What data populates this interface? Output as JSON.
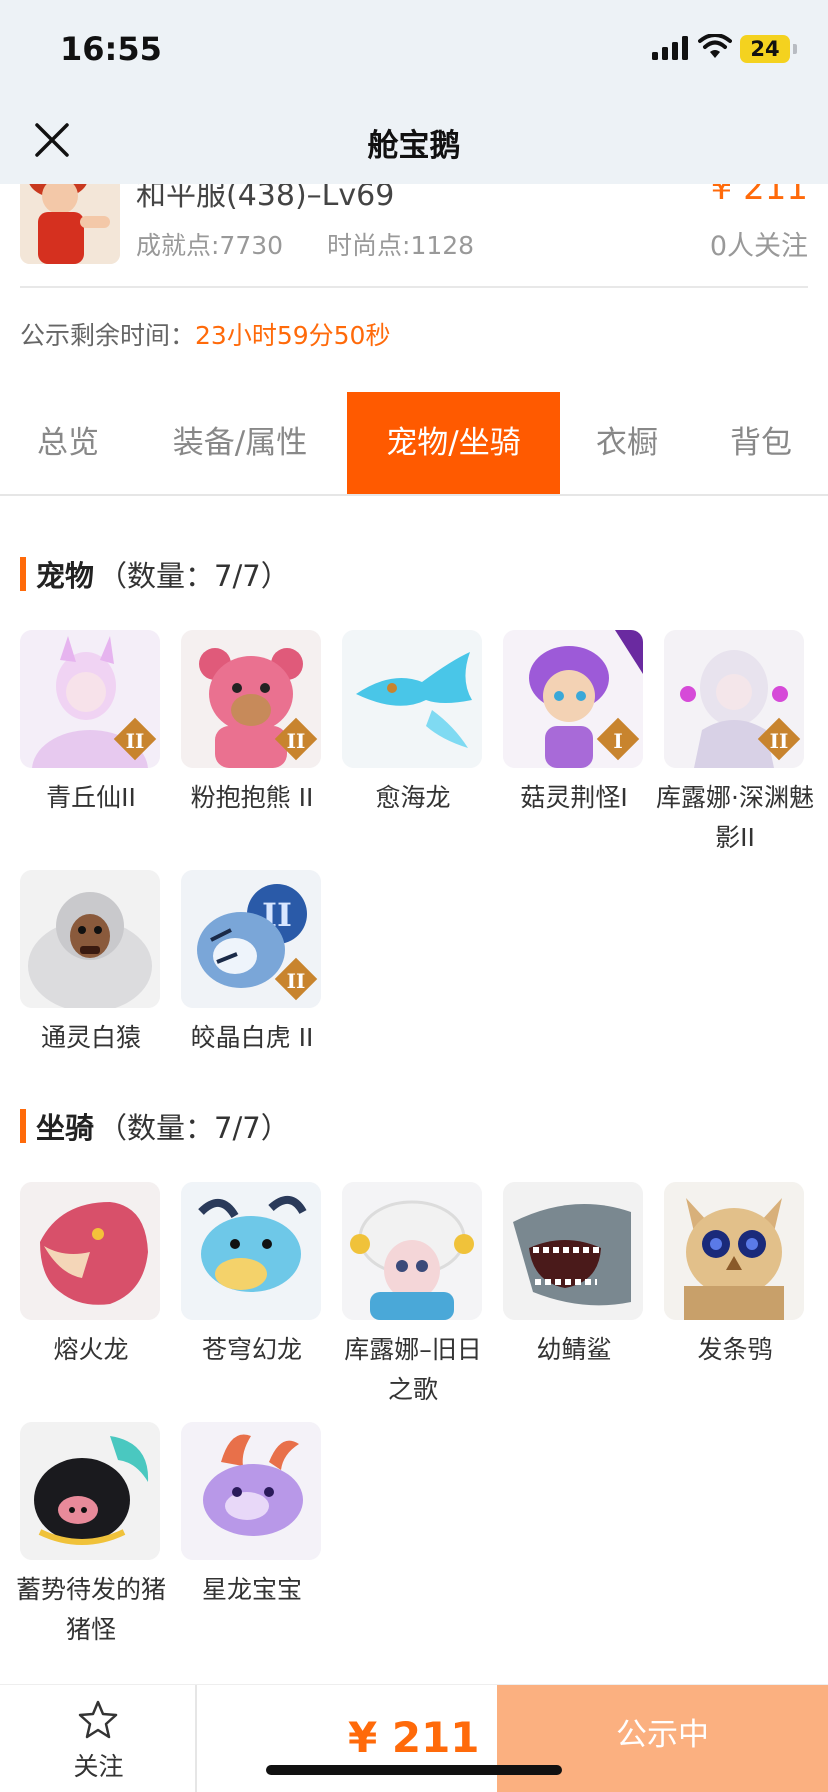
{
  "status_bar": {
    "time": "16:55",
    "battery": "24"
  },
  "nav": {
    "title": "舱宝鹅"
  },
  "account": {
    "title": "和平服(438)–Lv69",
    "price": "¥ 211",
    "achievement": "成就点:7730",
    "fashion": "时尚点:1128",
    "followers": "0人关注"
  },
  "countdown": {
    "label": "公示剩余时间：",
    "value": "23小时59分50秒"
  },
  "tabs": [
    {
      "label": "总览"
    },
    {
      "label": "装备/属性"
    },
    {
      "label": "宠物/坐骑"
    },
    {
      "label": "衣橱"
    },
    {
      "label": "背包"
    }
  ],
  "active_tab": "宠物/坐骑",
  "pets": {
    "title": "宠物",
    "count": "（数量：7/7）",
    "items": [
      {
        "name": "青丘仙II"
      },
      {
        "name": "粉抱抱熊 II"
      },
      {
        "name": "愈海龙"
      },
      {
        "name": "菇灵荆怪I"
      },
      {
        "name": "库露娜·深渊魅影II"
      },
      {
        "name": "通灵白猿"
      },
      {
        "name": "皎晶白虎 II"
      }
    ]
  },
  "mounts": {
    "title": "坐骑",
    "count": "（数量：7/7）",
    "items": [
      {
        "name": "熔火龙"
      },
      {
        "name": "苍穹幻龙"
      },
      {
        "name": "库露娜–旧日之歌"
      },
      {
        "name": "幼鲭鲨"
      },
      {
        "name": "发条鸮"
      },
      {
        "name": "蓄势待发的猪猪怪"
      },
      {
        "name": "星龙宝宝"
      }
    ]
  },
  "bottom_bar": {
    "follow_label": "关注",
    "price": "¥ 211",
    "status": "公示中"
  },
  "colors": {
    "accent": "#ff6a0a",
    "tab_active": "#ff5a00",
    "status_button": "#fbb080"
  }
}
